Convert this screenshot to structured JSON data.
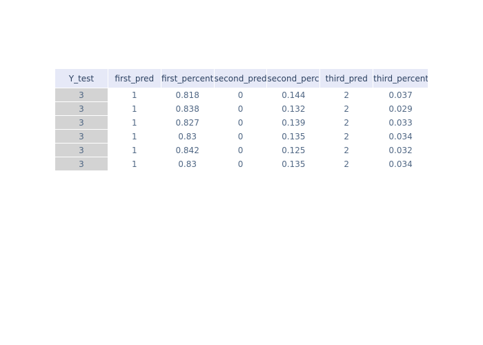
{
  "chart_data": {
    "type": "table",
    "columns": [
      "Y_test",
      "first_pred",
      "first_percent",
      "second_pred",
      "second_percent",
      "third_pred",
      "third_percent"
    ],
    "rows": [
      [
        "3",
        "1",
        "0.818",
        "0",
        "0.144",
        "2",
        "0.037"
      ],
      [
        "3",
        "1",
        "0.838",
        "0",
        "0.132",
        "2",
        "0.029"
      ],
      [
        "3",
        "1",
        "0.827",
        "0",
        "0.139",
        "2",
        "0.033"
      ],
      [
        "3",
        "1",
        "0.83",
        "0",
        "0.135",
        "2",
        "0.034"
      ],
      [
        "3",
        "1",
        "0.842",
        "0",
        "0.125",
        "2",
        "0.032"
      ],
      [
        "3",
        "1",
        "0.83",
        "0",
        "0.135",
        "2",
        "0.034"
      ]
    ],
    "colors": {
      "header_fill": "#e6e9f7",
      "first_column_fill": "#d3d3d3",
      "cell_fill": "#ffffff",
      "text": "#506784"
    }
  }
}
